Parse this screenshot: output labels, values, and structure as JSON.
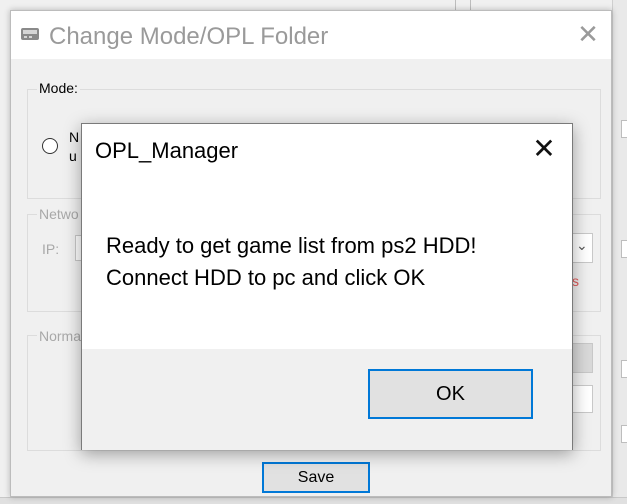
{
  "change_mode_window": {
    "title": "Change Mode/OPL Folder",
    "close_glyph": "✕",
    "mode_group": {
      "label": "Mode:",
      "option_partial_line1": "N",
      "option_partial_line2": "u"
    },
    "network_group": {
      "label": "Netwo",
      "ip_label": "IP:",
      "dropdown_arrow": "⌄",
      "warning_partial": "s"
    },
    "normal_group": {
      "label": "Norma"
    },
    "save_label": "Save"
  },
  "dialog": {
    "title": "OPL_Manager",
    "close_glyph": "✕",
    "message": "Ready to get game list from ps2 HDD!\nConnect HDD to pc and click OK",
    "ok_label": "OK"
  },
  "colors": {
    "accent": "#0078d7",
    "window_bg": "#f0f0f0",
    "dim_text": "#a8a8a8"
  }
}
